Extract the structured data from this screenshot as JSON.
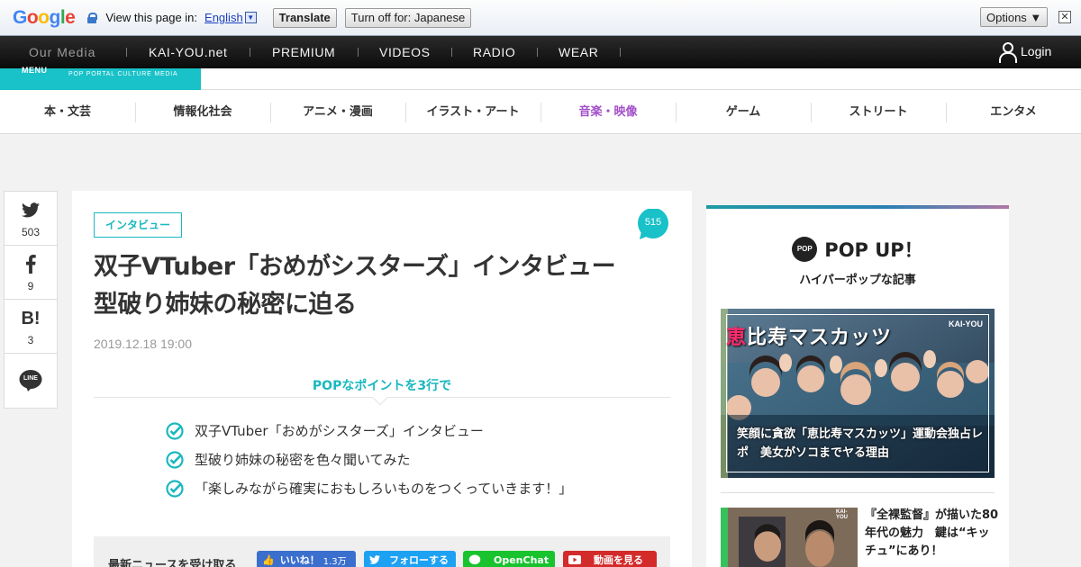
{
  "translate_bar": {
    "logo": [
      "G",
      "o",
      "o",
      "g",
      "l",
      "e"
    ],
    "view_text": "View this page in:",
    "language": "English",
    "translate_label": "Translate",
    "turn_off_label": "Turn off for: Japanese",
    "options_label": "Options ▼",
    "close_glyph": "✕"
  },
  "topnav": {
    "our_media": "Our Media",
    "items": [
      "KAI-YOU.net",
      "PREMIUM",
      "VIDEOS",
      "RADIO",
      "WEAR"
    ],
    "login": "Login"
  },
  "header": {
    "menu_label": "MENU",
    "tagline": "POP PORTAL CULTURE MEDIA"
  },
  "categories": [
    {
      "label": "本・文芸",
      "active": false
    },
    {
      "label": "情報化社会",
      "active": false
    },
    {
      "label": "アニメ・漫画",
      "active": false
    },
    {
      "label": "イラスト・アート",
      "active": false
    },
    {
      "label": "音楽・映像",
      "active": true
    },
    {
      "label": "ゲーム",
      "active": false
    },
    {
      "label": "ストリート",
      "active": false
    },
    {
      "label": "エンタメ",
      "active": false
    }
  ],
  "share": {
    "twitter_count": "503",
    "facebook_count": "9",
    "hatena_label": "B!",
    "hatena_count": "3",
    "line_label": "LINE"
  },
  "article": {
    "tag": "インタビュー",
    "comment_count": "515",
    "title_line1": "双子VTuber「おめがシスターズ」インタビュー",
    "title_line2": "型破り姉妹の秘密に迫る",
    "date": "2019.12.18 19:00",
    "points_heading": "POPなポイントを3行で",
    "points": [
      "双子VTuber「おめがシスターズ」インタビュー",
      "型破り姉妹の秘密を色々聞いてみた",
      "「楽しみながら確実におもしろいものをつくっていきます！」"
    ],
    "news_label": "最新ニュースを受け取る",
    "like_label": "いいね！",
    "like_count": "1.3万",
    "follow_label": "フォローする",
    "openchat_label": "OpenChat",
    "video_label": "動画を見る"
  },
  "sidebar": {
    "badge": "POP",
    "title": "POP UP！",
    "subtitle": "ハイパーポップな記事",
    "feature_head_accent": "恵",
    "feature_head_rest": "比寿マスカッツ",
    "feature_brand": "KAI-YOU",
    "feature_caption": "笑顔に貪欲「恵比寿マスカッツ」運動会独占レポ　美女がソコまでヤる理由",
    "thumb_brand": "KAI-YOU",
    "second_title": "『全裸監督』が描いた80年代の魅力　鍵は“キッチュ”にあり！"
  },
  "colors": {
    "accent_teal": "#19b8bf",
    "active_category": "#a24fc9",
    "facebook": "#3b6fce",
    "twitter": "#1da1f2",
    "line": "#19c32e",
    "youtube": "#d32a2a"
  }
}
